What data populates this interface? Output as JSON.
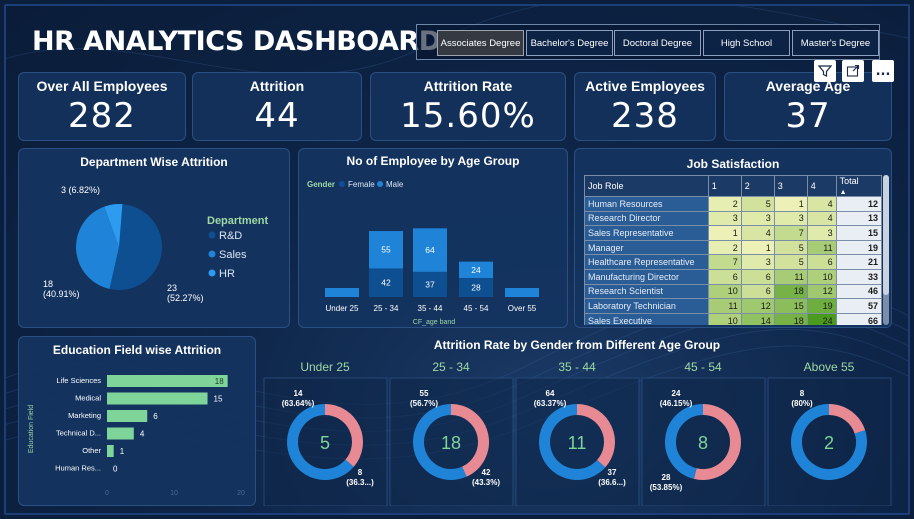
{
  "title": "HR ANALYTICS DASHBOARD",
  "education_slicer": {
    "options": [
      "Associates Degree",
      "Bachelor's Degree",
      "Doctoral Degree",
      "High School",
      "Master's Degree"
    ],
    "selected": "Associates Degree"
  },
  "kpis": [
    {
      "label": "Over All Employees",
      "value": "282"
    },
    {
      "label": "Attrition",
      "value": "44"
    },
    {
      "label": "Attrition Rate",
      "value": "15.60%"
    },
    {
      "label": "Active Employees",
      "value": "238"
    },
    {
      "label": "Average Age",
      "value": "37"
    }
  ],
  "toolbar": {
    "icons": [
      "filter-icon",
      "focus-mode-icon",
      "more-options-icon"
    ],
    "more_label": "..."
  },
  "colors": {
    "dark_blue": "#0e4f91",
    "blue": "#1f84d8",
    "light_blue": "#2d9bf0",
    "pink": "#e88a93",
    "green": "#7fd49a",
    "heading_green": "#9fd8a3"
  },
  "department_attrition": {
    "title": "Department Wise Attrition",
    "legend_title": "Department",
    "legend": [
      "R&D",
      "Sales",
      "HR"
    ],
    "slices": [
      {
        "name": "R&D",
        "value": 23,
        "label": "23\n(52.27%)"
      },
      {
        "name": "Sales",
        "value": 18,
        "label": "18\n(40.91%)"
      },
      {
        "name": "HR",
        "value": 3,
        "label": "3 (6.82%)"
      }
    ]
  },
  "age_group": {
    "title": "No of Employee by Age Group",
    "legend_title": "Gender",
    "legend": [
      "Female",
      "Male"
    ],
    "x_label": "CF_age band",
    "categories": [
      "Under 25",
      "25 - 34",
      "35 - 44",
      "45 - 54",
      "Over 55"
    ],
    "female": [
      null,
      42,
      37,
      28,
      null
    ],
    "male": [
      null,
      55,
      64,
      24,
      null
    ],
    "bar_labels_female": [
      "",
      "42",
      "37",
      "28",
      ""
    ],
    "bar_labels_male": [
      "",
      "55",
      "64",
      "24",
      ""
    ]
  },
  "job_satisfaction": {
    "title": "Job Satisfaction",
    "headers": [
      "Job Role",
      "1",
      "2",
      "3",
      "4",
      "Total"
    ],
    "rows": [
      [
        "Human Resources",
        "2",
        "5",
        "1",
        "4",
        "12"
      ],
      [
        "Research Director",
        "3",
        "3",
        "3",
        "4",
        "13"
      ],
      [
        "Sales Representative",
        "1",
        "4",
        "7",
        "3",
        "15"
      ],
      [
        "Manager",
        "2",
        "1",
        "5",
        "11",
        "19"
      ],
      [
        "Healthcare Representative",
        "7",
        "3",
        "5",
        "6",
        "21"
      ],
      [
        "Manufacturing Director",
        "6",
        "6",
        "11",
        "10",
        "33"
      ],
      [
        "Research Scientist",
        "10",
        "6",
        "18",
        "12",
        "46"
      ],
      [
        "Laboratory Technician",
        "11",
        "12",
        "15",
        "19",
        "57"
      ],
      [
        "Sales Executive",
        "10",
        "14",
        "18",
        "24",
        "66"
      ]
    ]
  },
  "education_field": {
    "title": "Education Field wise Attrition",
    "y_label": "Education Field",
    "categories": [
      "Life Sciences",
      "Medical",
      "Marketing",
      "Technical D...",
      "Other",
      "Human Res..."
    ],
    "values": [
      18,
      15,
      6,
      4,
      1,
      0
    ],
    "x_ticks": [
      "0",
      "10",
      "20"
    ],
    "xlim": [
      0,
      20
    ]
  },
  "gender_age": {
    "title": "Attrition Rate by Gender from Different Age Group",
    "groups": [
      {
        "name": "Under 25",
        "total": "5",
        "male": 14,
        "female": 8,
        "male_label": "14\n(63.64%)",
        "female_label": "8\n(36.3...)"
      },
      {
        "name": "25 - 34",
        "total": "18",
        "male": 55,
        "female": 42,
        "male_label": "55\n(56.7%)",
        "female_label": "42\n(43.3%)"
      },
      {
        "name": "35 - 44",
        "total": "11",
        "male": 64,
        "female": 37,
        "male_label": "64\n(63.37%)",
        "female_label": "37\n(36.6...)"
      },
      {
        "name": "45 - 54",
        "total": "8",
        "male": 24,
        "female": 28,
        "male_label": "24\n(46.15%)",
        "female_label": "28\n(53.85%)"
      },
      {
        "name": "Above 55",
        "total": "2",
        "male": 8,
        "female": 2,
        "male_label": "8\n(80%)",
        "female_label": ""
      }
    ]
  }
}
